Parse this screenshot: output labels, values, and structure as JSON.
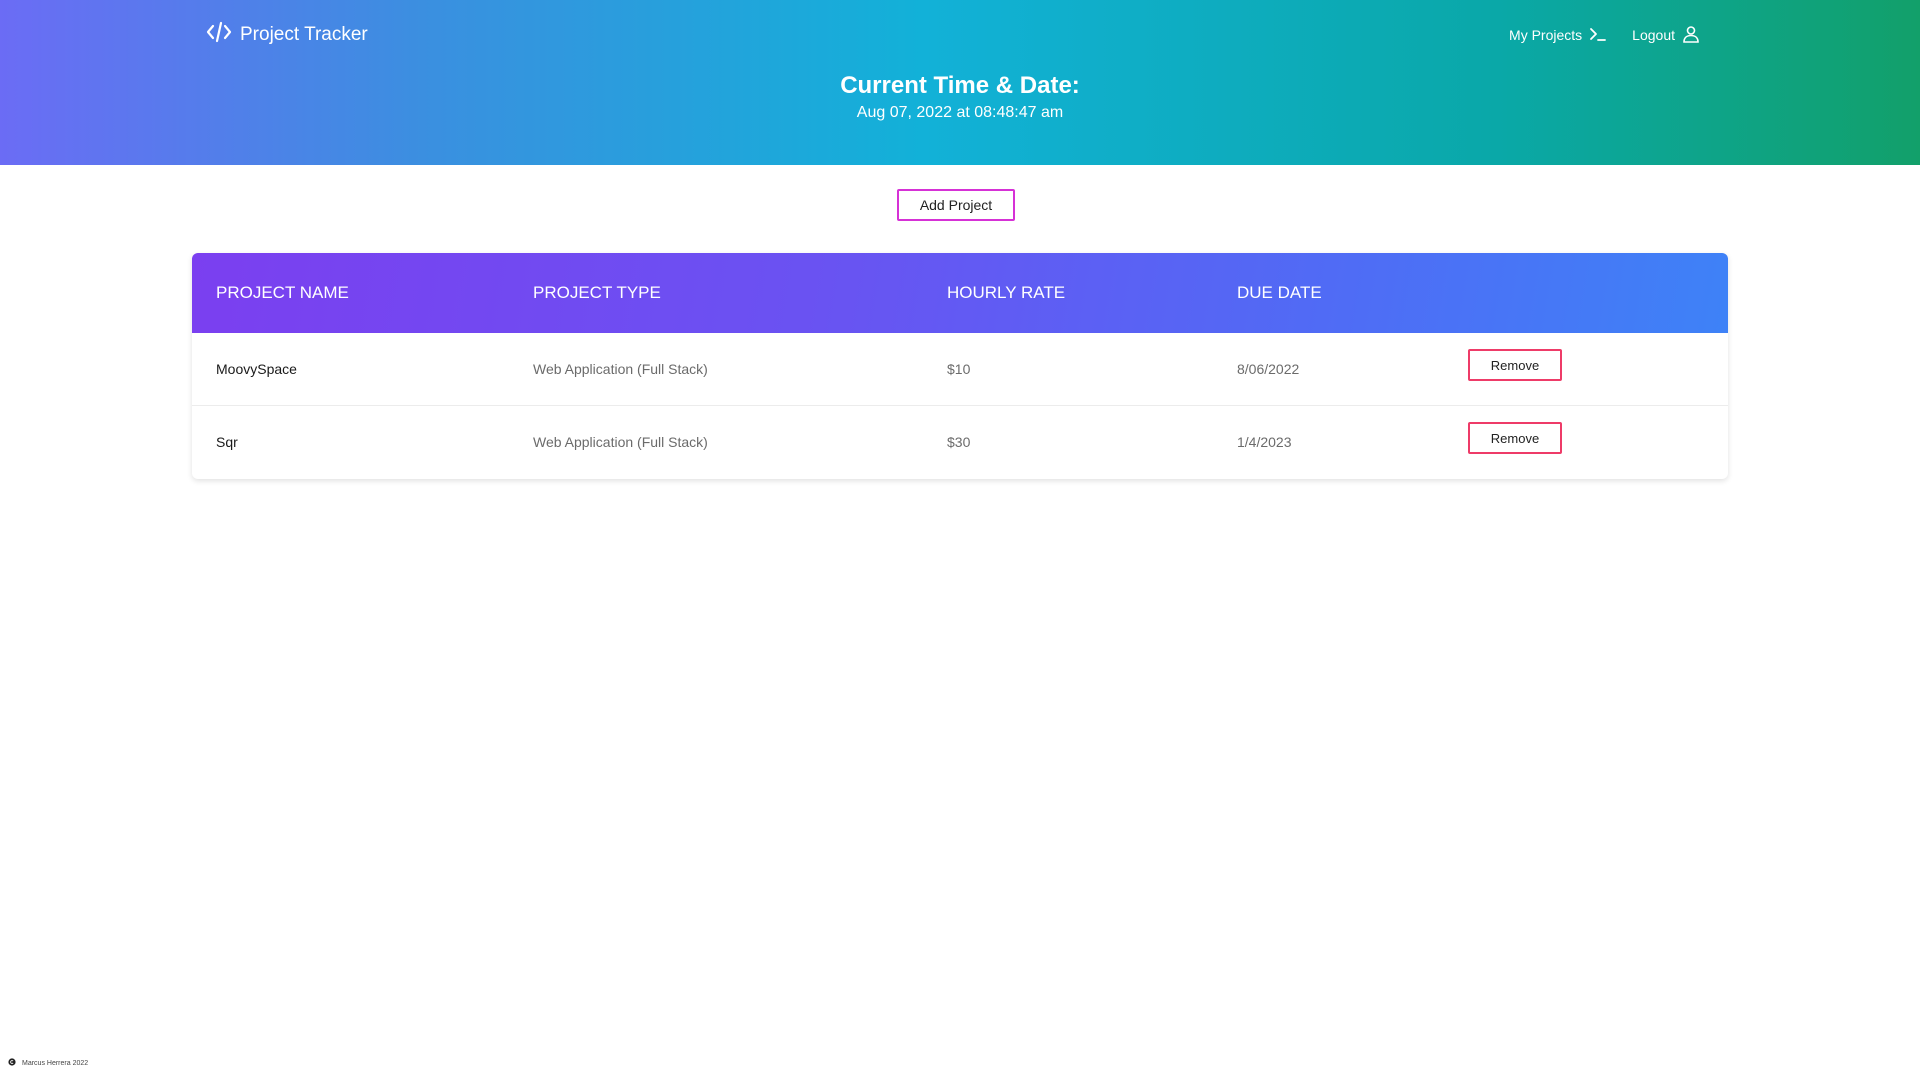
{
  "header": {
    "brand": "Project Tracker",
    "brand_icon": "code-icon",
    "nav": [
      {
        "label": "My Projects",
        "icon": "terminal-icon"
      },
      {
        "label": "Logout",
        "icon": "user-icon"
      }
    ],
    "title": "Current Time & Date:",
    "datetime": "Aug 07, 2022 at 08:48:47 am"
  },
  "actions": {
    "add_project": "Add Project"
  },
  "table": {
    "columns": [
      "PROJECT NAME",
      "PROJECT TYPE",
      "HOURLY RATE",
      "DUE DATE"
    ],
    "rows": [
      {
        "name": "MoovySpace",
        "type": "Web Application (Full Stack)",
        "rate": "$10",
        "due": "8/06/2022",
        "action": "Remove"
      },
      {
        "name": "Sqr",
        "type": "Web Application (Full Stack)",
        "rate": "$30",
        "due": "1/4/2023",
        "action": "Remove"
      }
    ]
  },
  "footer": {
    "text": "Marcus Herrera 2022",
    "icon": "copyright-icon"
  },
  "colors": {
    "add_button_border": "#d631d6",
    "remove_button_border": "#ee3b68"
  }
}
